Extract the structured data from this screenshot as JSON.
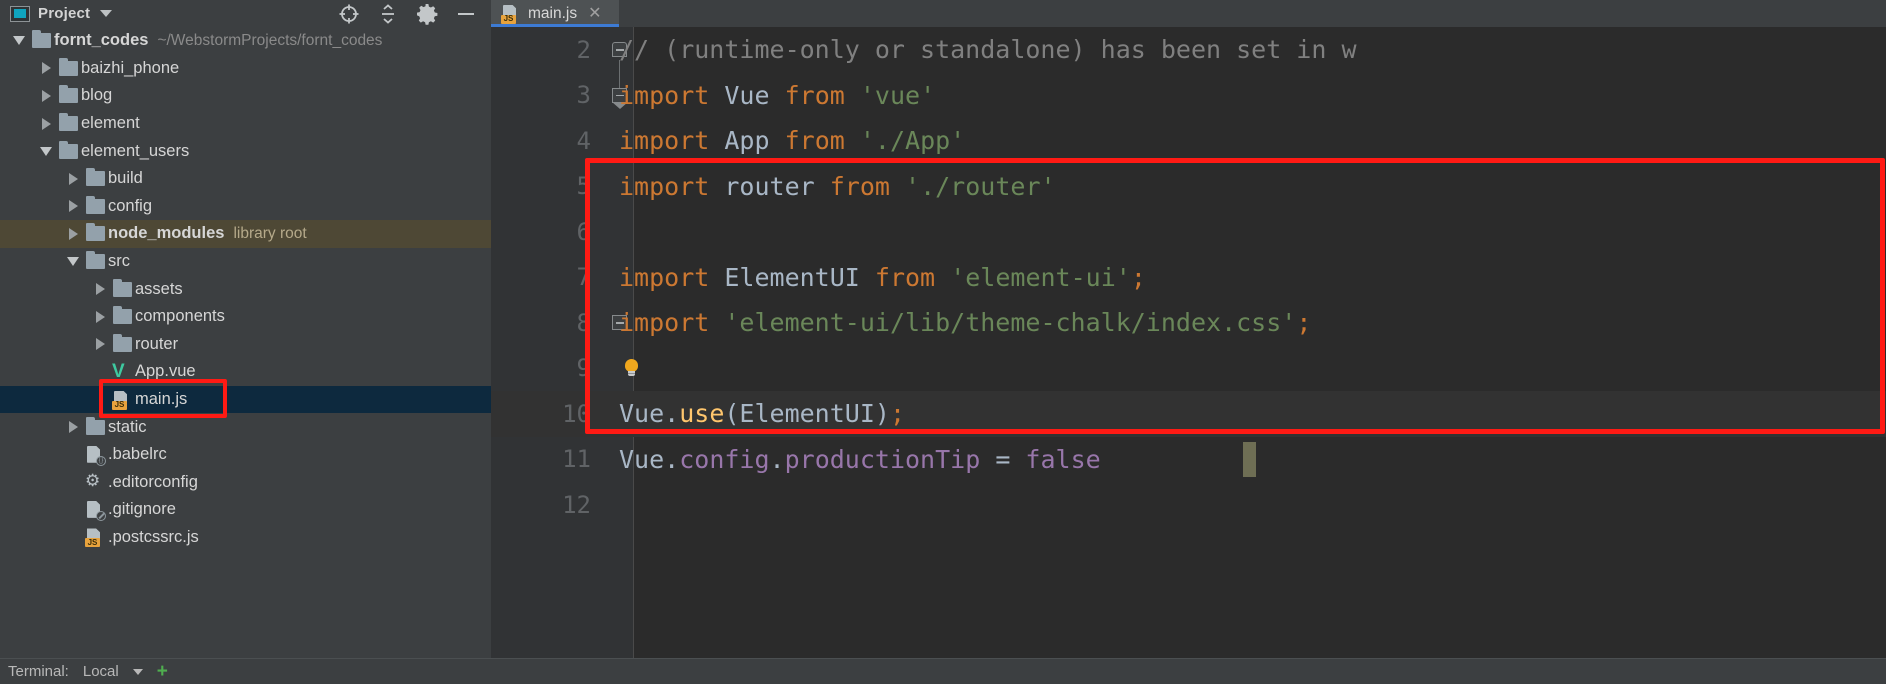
{
  "tool_window": {
    "title": "Project",
    "dropdown_icon": "chevron-down-icon",
    "actions": [
      {
        "name": "locate-icon",
        "tooltip": "Select Opened File"
      },
      {
        "name": "collapse-all-icon",
        "tooltip": "Collapse All"
      },
      {
        "name": "settings-gear-icon",
        "tooltip": "Settings"
      },
      {
        "name": "hide-icon",
        "tooltip": "Hide"
      }
    ]
  },
  "tree": [
    {
      "label": "fornt_codes",
      "secondary": "~/WebstormProjects/fornt_codes",
      "icon": "folder-icon",
      "state": "expanded",
      "depth": 0,
      "bold": true,
      "selected": false
    },
    {
      "label": "baizhi_phone",
      "secondary": "",
      "icon": "folder-icon",
      "state": "collapsed",
      "depth": 1,
      "bold": false,
      "selected": false
    },
    {
      "label": "blog",
      "secondary": "",
      "icon": "folder-icon",
      "state": "collapsed",
      "depth": 1,
      "bold": false,
      "selected": false
    },
    {
      "label": "element",
      "secondary": "",
      "icon": "folder-icon",
      "state": "collapsed",
      "depth": 1,
      "bold": false,
      "selected": false
    },
    {
      "label": "element_users",
      "secondary": "",
      "icon": "folder-icon",
      "state": "expanded",
      "depth": 1,
      "bold": false,
      "selected": false
    },
    {
      "label": "build",
      "secondary": "",
      "icon": "folder-icon",
      "state": "collapsed",
      "depth": 2,
      "bold": false,
      "selected": false
    },
    {
      "label": "config",
      "secondary": "",
      "icon": "folder-icon",
      "state": "collapsed",
      "depth": 2,
      "bold": false,
      "selected": false
    },
    {
      "label": "node_modules",
      "secondary": "library root",
      "icon": "folder-icon",
      "state": "collapsed",
      "depth": 2,
      "bold": true,
      "selected": false,
      "library_root": true
    },
    {
      "label": "src",
      "secondary": "",
      "icon": "folder-icon",
      "state": "expanded",
      "depth": 2,
      "bold": false,
      "selected": false
    },
    {
      "label": "assets",
      "secondary": "",
      "icon": "folder-icon",
      "state": "collapsed",
      "depth": 3,
      "bold": false,
      "selected": false
    },
    {
      "label": "components",
      "secondary": "",
      "icon": "folder-icon",
      "state": "collapsed",
      "depth": 3,
      "bold": false,
      "selected": false
    },
    {
      "label": "router",
      "secondary": "",
      "icon": "folder-icon",
      "state": "collapsed",
      "depth": 3,
      "bold": false,
      "selected": false
    },
    {
      "label": "App.vue",
      "secondary": "",
      "icon": "vue-file-icon",
      "state": "leaf",
      "depth": 3,
      "bold": false,
      "selected": false
    },
    {
      "label": "main.js",
      "secondary": "",
      "icon": "js-file-icon",
      "state": "leaf",
      "depth": 3,
      "bold": false,
      "selected": true,
      "annotated": true
    },
    {
      "label": "static",
      "secondary": "",
      "icon": "folder-icon",
      "state": "collapsed",
      "depth": 2,
      "bold": false,
      "selected": false
    },
    {
      "label": ".babelrc",
      "secondary": "",
      "icon": "json-file-icon",
      "state": "leaf",
      "depth": 2,
      "bold": false,
      "selected": false
    },
    {
      "label": ".editorconfig",
      "secondary": "",
      "icon": "gear-file-icon",
      "state": "leaf",
      "depth": 2,
      "bold": false,
      "selected": false
    },
    {
      "label": ".gitignore",
      "secondary": "",
      "icon": "ignored-file-icon",
      "state": "leaf",
      "depth": 2,
      "bold": false,
      "selected": false
    },
    {
      "label": ".postcssrc.js",
      "secondary": "",
      "icon": "js-file-icon",
      "state": "leaf",
      "depth": 2,
      "bold": false,
      "selected": false
    }
  ],
  "editor": {
    "tab": {
      "label": "main.js",
      "icon": "js-file-icon",
      "close_icon": "close-icon",
      "active": true
    },
    "lines": [
      {
        "number": "2",
        "fold": "top",
        "tokens": [
          {
            "t": "// (runtime-only or standalone) has been set in w",
            "c": "cmt"
          }
        ]
      },
      {
        "number": "3",
        "fold": "bottom",
        "tokens": [
          {
            "t": "import",
            "c": "kw"
          },
          {
            "t": " ",
            "c": "id"
          },
          {
            "t": "Vue",
            "c": "id"
          },
          {
            "t": " ",
            "c": "id"
          },
          {
            "t": "from",
            "c": "kw"
          },
          {
            "t": " ",
            "c": "id"
          },
          {
            "t": "'vue'",
            "c": "str"
          }
        ]
      },
      {
        "number": "4",
        "fold": "",
        "tokens": [
          {
            "t": "import",
            "c": "kw"
          },
          {
            "t": " ",
            "c": "id"
          },
          {
            "t": "App",
            "c": "id"
          },
          {
            "t": " ",
            "c": "id"
          },
          {
            "t": "from",
            "c": "kw"
          },
          {
            "t": " ",
            "c": "id"
          },
          {
            "t": "'./App'",
            "c": "str"
          }
        ]
      },
      {
        "number": "5",
        "fold": "",
        "tokens": [
          {
            "t": "import",
            "c": "kw"
          },
          {
            "t": " ",
            "c": "id"
          },
          {
            "t": "router",
            "c": "id"
          },
          {
            "t": " ",
            "c": "id"
          },
          {
            "t": "from",
            "c": "kw"
          },
          {
            "t": " ",
            "c": "id"
          },
          {
            "t": "'./router'",
            "c": "str"
          }
        ]
      },
      {
        "number": "6",
        "fold": "",
        "tokens": []
      },
      {
        "number": "7",
        "fold": "",
        "tokens": [
          {
            "t": "import",
            "c": "kw"
          },
          {
            "t": " ",
            "c": "id"
          },
          {
            "t": "ElementUI",
            "c": "id"
          },
          {
            "t": " ",
            "c": "id"
          },
          {
            "t": "from",
            "c": "kw"
          },
          {
            "t": " ",
            "c": "id"
          },
          {
            "t": "'element-ui'",
            "c": "str"
          },
          {
            "t": ";",
            "c": "punc"
          }
        ]
      },
      {
        "number": "8",
        "fold": "single",
        "tokens": [
          {
            "t": "import",
            "c": "kw"
          },
          {
            "t": " ",
            "c": "id"
          },
          {
            "t": "'element-ui/lib/theme-chalk/index.css'",
            "c": "str"
          },
          {
            "t": ";",
            "c": "punc"
          }
        ]
      },
      {
        "number": "9",
        "fold": "",
        "bulb": true,
        "tokens": []
      },
      {
        "number": "10",
        "fold": "",
        "current": true,
        "tokens": [
          {
            "t": "Vue",
            "c": "id"
          },
          {
            "t": ".",
            "c": "id"
          },
          {
            "t": "use",
            "c": "fn"
          },
          {
            "t": "(ElementUI)",
            "c": "id"
          },
          {
            "t": ";",
            "c": "punc"
          }
        ]
      },
      {
        "number": "11",
        "fold": "",
        "caret": true,
        "tokens": [
          {
            "t": "Vue",
            "c": "id"
          },
          {
            "t": ".",
            "c": "id"
          },
          {
            "t": "config",
            "c": "fld"
          },
          {
            "t": ".",
            "c": "id"
          },
          {
            "t": "productionTip",
            "c": "fld"
          },
          {
            "t": " = ",
            "c": "id"
          },
          {
            "t": "false",
            "c": "fld"
          }
        ]
      },
      {
        "number": "12",
        "fold": "",
        "tokens": []
      }
    ]
  },
  "status_bar": {
    "terminal_label": "Terminal:",
    "session_label": "Local",
    "dropdown_icon": "chevron-down-icon",
    "add_icon": "plus-icon"
  },
  "annotations": [
    {
      "name": "main-js-highlight",
      "shape": "rectangle",
      "color": "#ff1a14"
    },
    {
      "name": "code-block-highlight",
      "shape": "rectangle",
      "color": "#ff1a14"
    }
  ],
  "colors": {
    "panel_bg": "#3c3f41",
    "editor_bg": "#2b2b2b",
    "selection_bg": "#0d293e",
    "library_root_bg": "#4e4835",
    "keyword": "#cc7832",
    "string": "#6a8759",
    "comment": "#808080",
    "function": "#ffc66d",
    "field": "#9876aa",
    "identifier": "#a9b7c6",
    "tab_underline": "#3d7bd4",
    "annotation": "#ff1a14"
  }
}
